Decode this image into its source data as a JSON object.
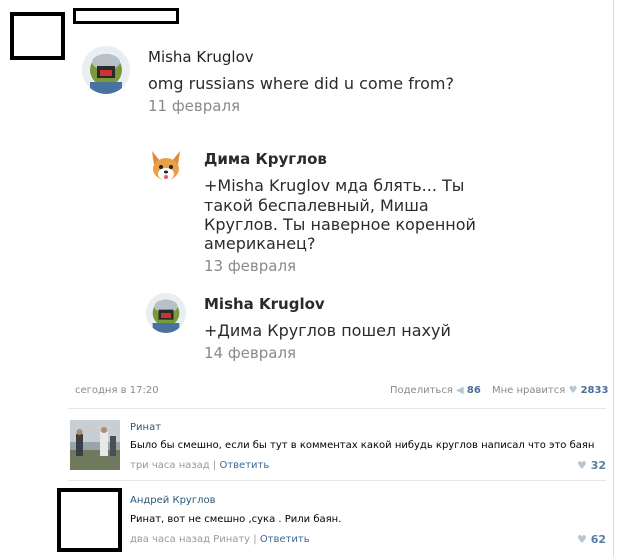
{
  "post": {
    "comment1": {
      "author": "Misha Kruglov",
      "text": "omg russians where did u come from?",
      "date": "11 февраля"
    },
    "reply1": {
      "author": "Дима Круглов",
      "text_lines": [
        "+Misha Kruglov мда блять... Ты",
        "такой беспалевный, Миша",
        "Круглов. Ты наверное коренной",
        "американец?"
      ],
      "date": "13 февраля"
    },
    "reply2": {
      "author": "Misha Kruglov",
      "text": "+Дима Круглов пошел нахуй",
      "date": "14 февраля"
    }
  },
  "footer": {
    "timestamp": "сегодня в 17:20",
    "share_label": "Поделиться",
    "share_count": "86",
    "like_label": "Мне нравится",
    "like_count": "2833"
  },
  "comments": [
    {
      "author": "Ринат",
      "text": "Было бы смешно, если бы тут в комментах какой нибудь круглов написал что это баян",
      "time": "три часа назад",
      "reply_label": "Ответить",
      "likes": "32"
    },
    {
      "author": "Андрей Круглов",
      "text": "Ринат, вот не смешно ,сука . Рили баян.",
      "time": "два часа назад Ринату",
      "reply_label": "Ответить",
      "likes": "62"
    }
  ],
  "colors": {
    "link": "#3b6a97",
    "muted": "#8a8a8a",
    "heart": "#b8c7d6"
  }
}
